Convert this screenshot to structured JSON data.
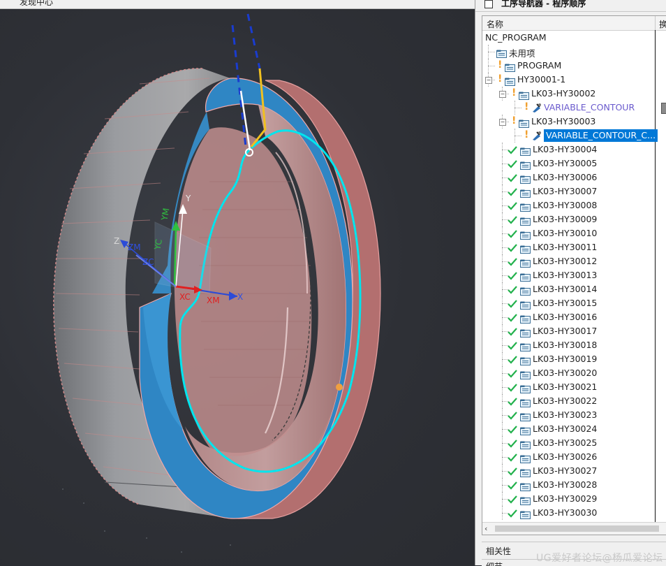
{
  "viewport": {
    "tab_title": "发现中心"
  },
  "axes": {
    "xc": "XC",
    "xm": "XM",
    "x": "X",
    "zm": "ZM",
    "zc": "ZC",
    "z": "Z",
    "ym": "YM",
    "yc": "YC",
    "y": "Y"
  },
  "navigator": {
    "title": "工序导航器 - 程序顺序",
    "columns": [
      "名称",
      "换"
    ],
    "rows": [
      {
        "label": "NC_PROGRAM",
        "status": "none",
        "icon": "none",
        "indent": 0
      },
      {
        "label": "未用项",
        "status": "none",
        "icon": "folder",
        "indent": 1
      },
      {
        "label": "PROGRAM",
        "status": "warning",
        "icon": "folder",
        "indent": 1
      },
      {
        "label": "HY30001-1",
        "status": "warning",
        "icon": "folder",
        "indent": 1,
        "toggle": "⊖"
      },
      {
        "label": "LK03-HY30002",
        "status": "warning",
        "icon": "folder",
        "indent": 2,
        "toggle": "⊖"
      },
      {
        "label": "VARIABLE_CONTOUR",
        "status": "warning",
        "icon": "operation",
        "indent": 3,
        "style": "purple"
      },
      {
        "label": "LK03-HY30003",
        "status": "warning",
        "icon": "folder",
        "indent": 2,
        "toggle": "⊖"
      },
      {
        "label": "VARIABLE_CONTOUR_C...",
        "status": "warning",
        "icon": "operation",
        "indent": 3,
        "style": "selected"
      },
      {
        "label": "LK03-HY30004",
        "status": "ok",
        "icon": "folder",
        "indent": 2
      },
      {
        "label": "LK03-HY30005",
        "status": "ok",
        "icon": "folder",
        "indent": 2
      },
      {
        "label": "LK03-HY30006",
        "status": "ok",
        "icon": "folder",
        "indent": 2
      },
      {
        "label": "LK03-HY30007",
        "status": "ok",
        "icon": "folder",
        "indent": 2
      },
      {
        "label": "LK03-HY30008",
        "status": "ok",
        "icon": "folder",
        "indent": 2
      },
      {
        "label": "LK03-HY30009",
        "status": "ok",
        "icon": "folder",
        "indent": 2
      },
      {
        "label": "LK03-HY30010",
        "status": "ok",
        "icon": "folder",
        "indent": 2
      },
      {
        "label": "LK03-HY30011",
        "status": "ok",
        "icon": "folder",
        "indent": 2
      },
      {
        "label": "LK03-HY30012",
        "status": "ok",
        "icon": "folder",
        "indent": 2
      },
      {
        "label": "LK03-HY30013",
        "status": "ok",
        "icon": "folder",
        "indent": 2
      },
      {
        "label": "LK03-HY30014",
        "status": "ok",
        "icon": "folder",
        "indent": 2
      },
      {
        "label": "LK03-HY30015",
        "status": "ok",
        "icon": "folder",
        "indent": 2
      },
      {
        "label": "LK03-HY30016",
        "status": "ok",
        "icon": "folder",
        "indent": 2
      },
      {
        "label": "LK03-HY30017",
        "status": "ok",
        "icon": "folder",
        "indent": 2
      },
      {
        "label": "LK03-HY30018",
        "status": "ok",
        "icon": "folder",
        "indent": 2
      },
      {
        "label": "LK03-HY30019",
        "status": "ok",
        "icon": "folder",
        "indent": 2
      },
      {
        "label": "LK03-HY30020",
        "status": "ok",
        "icon": "folder",
        "indent": 2
      },
      {
        "label": "LK03-HY30021",
        "status": "ok",
        "icon": "folder",
        "indent": 2
      },
      {
        "label": "LK03-HY30022",
        "status": "ok",
        "icon": "folder",
        "indent": 2
      },
      {
        "label": "LK03-HY30023",
        "status": "ok",
        "icon": "folder",
        "indent": 2
      },
      {
        "label": "LK03-HY30024",
        "status": "ok",
        "icon": "folder",
        "indent": 2
      },
      {
        "label": "LK03-HY30025",
        "status": "ok",
        "icon": "folder",
        "indent": 2
      },
      {
        "label": "LK03-HY30026",
        "status": "ok",
        "icon": "folder",
        "indent": 2
      },
      {
        "label": "LK03-HY30027",
        "status": "ok",
        "icon": "folder",
        "indent": 2
      },
      {
        "label": "LK03-HY30028",
        "status": "ok",
        "icon": "folder",
        "indent": 2
      },
      {
        "label": "LK03-HY30029",
        "status": "ok",
        "icon": "folder",
        "indent": 2
      },
      {
        "label": "LK03-HY30030",
        "status": "ok",
        "icon": "folder",
        "indent": 2
      }
    ]
  },
  "panels": {
    "dependencies": "相关性",
    "details": "细节"
  },
  "watermark": "UG爱好者论坛@杨瓜爱论坛",
  "colors": {
    "selection": "#0078d7",
    "ok": "#22b14c",
    "warning": "#f0a030",
    "toolpath": "#00e5ee",
    "part_blue": "#2f86c4",
    "part_red": "#c98282"
  }
}
